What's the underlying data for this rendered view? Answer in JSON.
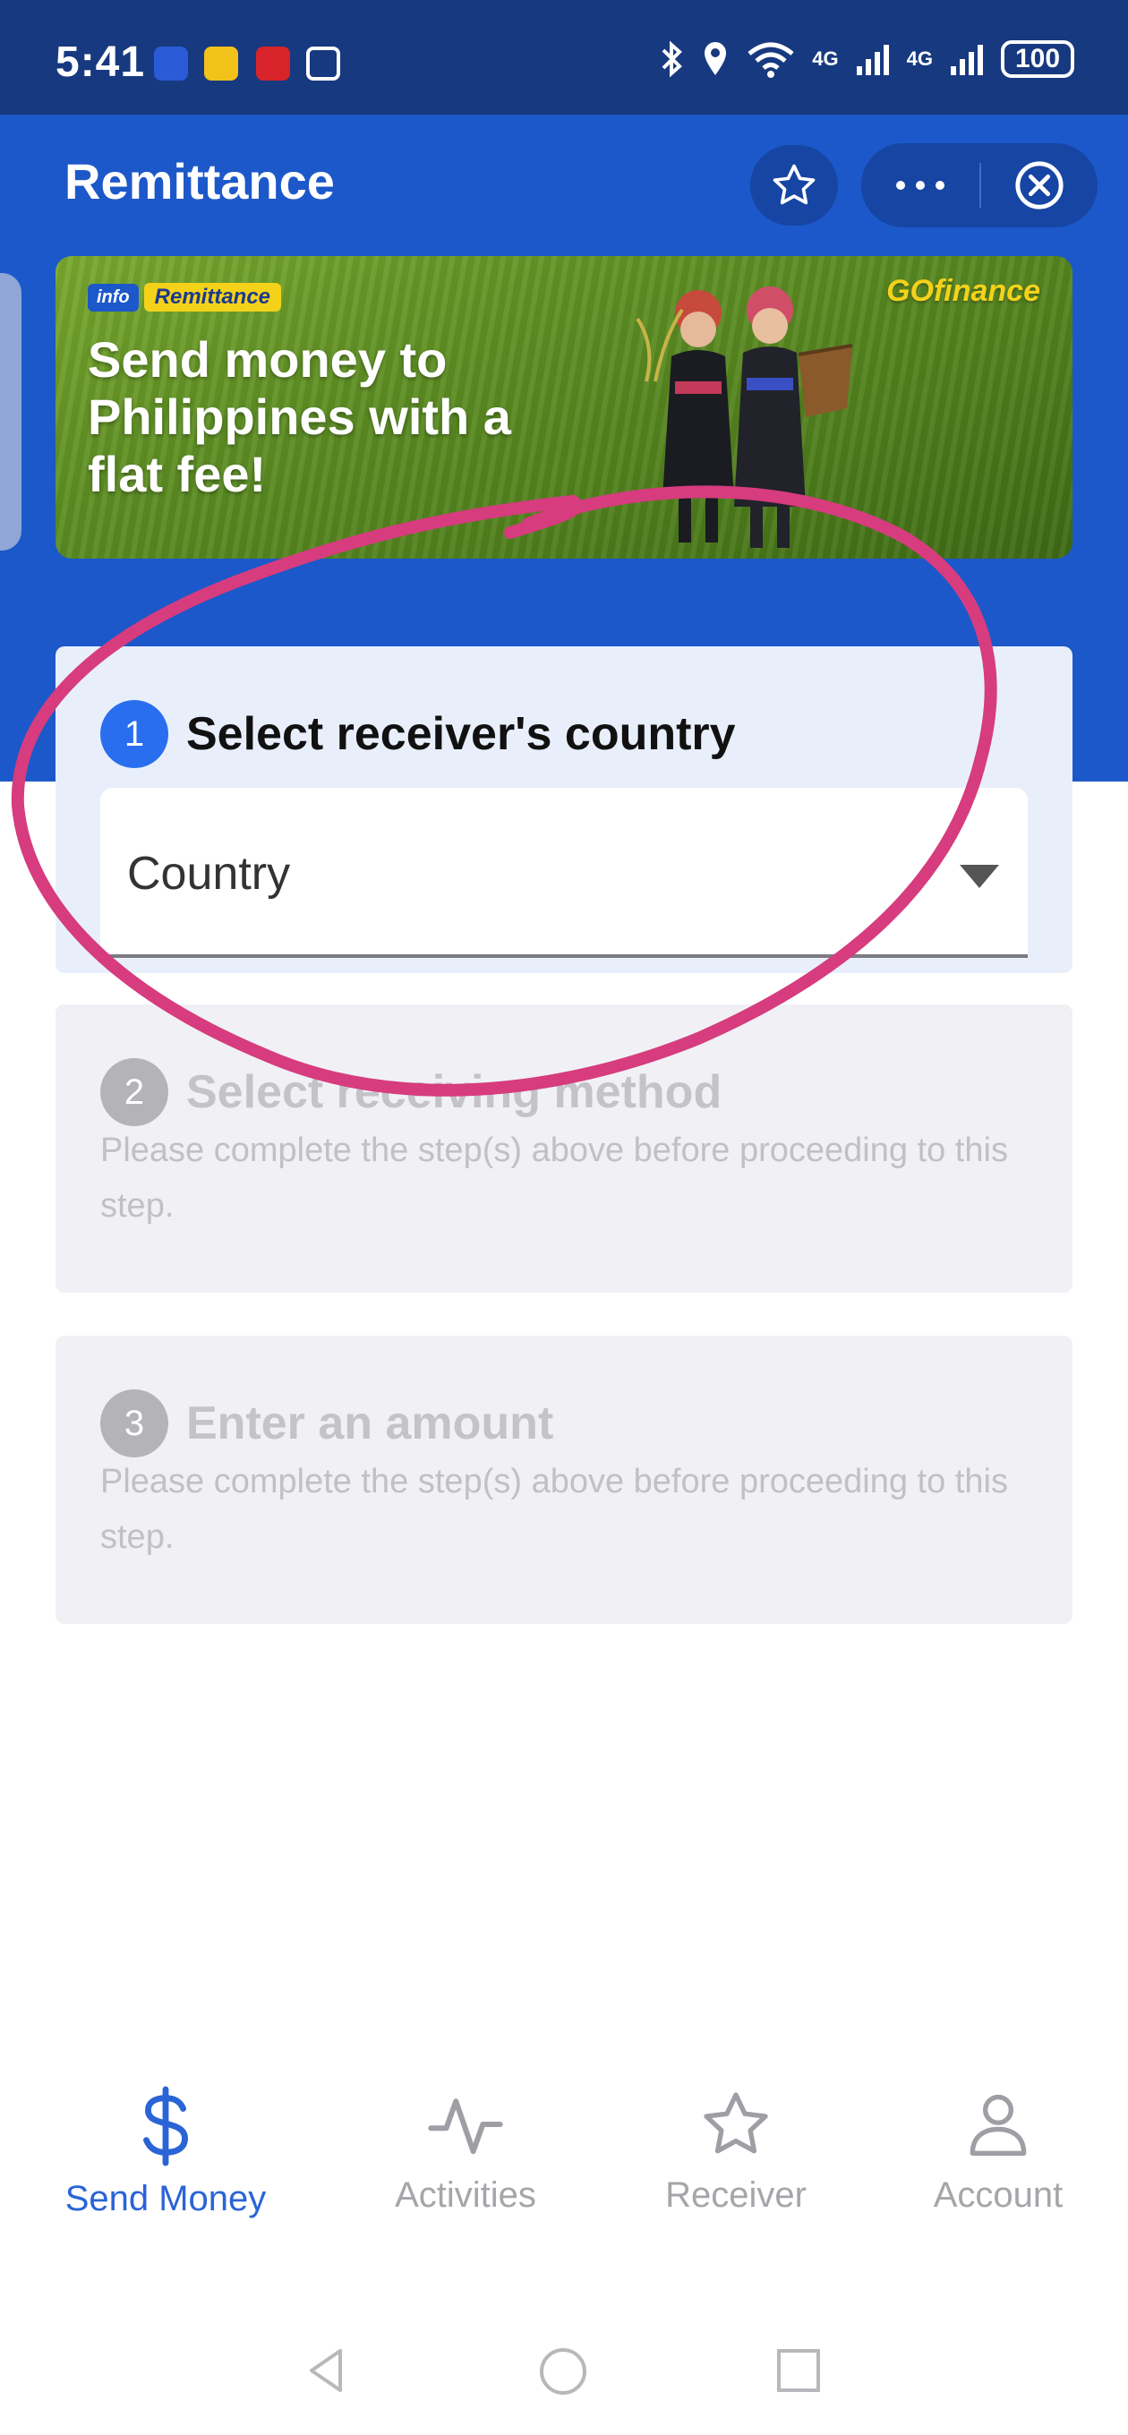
{
  "status_bar": {
    "time": "5:41",
    "network_1": "4G",
    "network_2": "4G",
    "battery": "100"
  },
  "header": {
    "title": "Remittance",
    "favorite_icon": "star-outline-icon",
    "more_icon": "more-dots-icon",
    "close_icon": "close-circle-icon"
  },
  "banner": {
    "tag_info": "info",
    "tag_label": "Remittance",
    "headline": "Send money to Philippines with a flat fee!",
    "brand": "GOfinance"
  },
  "steps": [
    {
      "number": "1",
      "title": "Select receiver's country",
      "state": "active"
    },
    {
      "number": "2",
      "title": "Select receiving method",
      "description": "Please complete the step(s) above before proceeding to this step.",
      "state": "disabled"
    },
    {
      "number": "3",
      "title": "Enter an amount",
      "description": "Please complete the step(s) above before proceeding to this step.",
      "state": "disabled"
    }
  ],
  "country_select": {
    "placeholder": "Country"
  },
  "bottom_nav": [
    {
      "label": "Send Money",
      "icon": "dollar-icon",
      "active": true
    },
    {
      "label": "Activities",
      "icon": "activity-pulse-icon",
      "active": false
    },
    {
      "label": "Receiver",
      "icon": "star-icon",
      "active": false
    },
    {
      "label": "Account",
      "icon": "user-icon",
      "active": false
    }
  ],
  "colors": {
    "primary": "#1c58c9",
    "status_bar": "#17397f",
    "accent": "#2a6ef0",
    "annotation": "#d63c7e"
  }
}
